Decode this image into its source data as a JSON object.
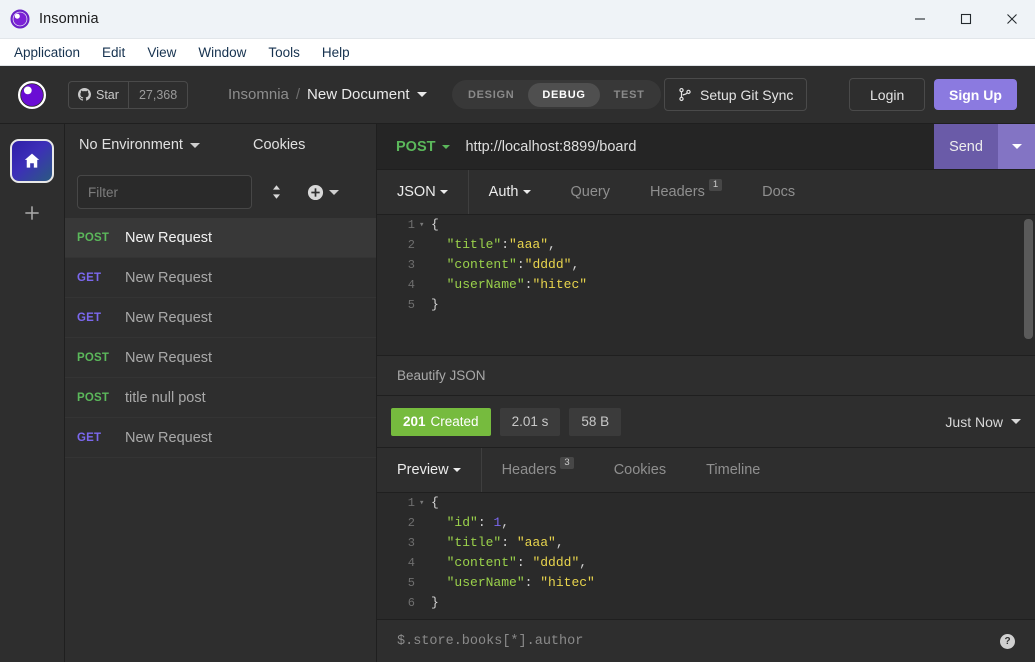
{
  "window": {
    "title": "Insomnia",
    "app_icon": "insomnia-logo-icon",
    "controls": {
      "minimize": "minimize-icon",
      "maximize": "maximize-icon",
      "close": "close-icon"
    }
  },
  "menubar": {
    "items": [
      "Application",
      "Edit",
      "View",
      "Window",
      "Tools",
      "Help"
    ]
  },
  "appheader": {
    "logo": "insomnia-logo-icon",
    "star": {
      "icon": "github-icon",
      "label": "Star",
      "count": "27,368"
    },
    "breadcrumb": {
      "app": "Insomnia",
      "separator": "/",
      "document": "New Document",
      "caret": "chevron-down-icon"
    },
    "modes": [
      {
        "label": "DESIGN",
        "active": false
      },
      {
        "label": "DEBUG",
        "active": true
      },
      {
        "label": "TEST",
        "active": false
      }
    ],
    "git_sync": {
      "icon": "git-branch-icon",
      "label": "Setup Git Sync"
    },
    "login": "Login",
    "signup": "Sign Up",
    "accent_color": "#8b7ae0"
  },
  "rail": {
    "home": "home-icon",
    "add": "plus-icon"
  },
  "sidebar": {
    "environment": {
      "label": "No Environment",
      "caret": "chevron-down-icon"
    },
    "cookies": "Cookies",
    "filter": {
      "value": "",
      "placeholder": "Filter"
    },
    "sort_icon": "sort-updown-icon",
    "add_icon": "circle-plus-icon",
    "requests": [
      {
        "method": "POST",
        "name": "New Request",
        "selected": true
      },
      {
        "method": "GET",
        "name": "New Request",
        "selected": false
      },
      {
        "method": "GET",
        "name": "New Request",
        "selected": false
      },
      {
        "method": "POST",
        "name": "New Request",
        "selected": false
      },
      {
        "method": "POST",
        "name": "title null post",
        "selected": false
      },
      {
        "method": "GET",
        "name": "New Request",
        "selected": false
      }
    ]
  },
  "request": {
    "method": "POST",
    "url": "http://localhost:8899/board",
    "send_label": "Send",
    "send_caret": "chevron-down-icon",
    "tabs": [
      {
        "label": "JSON",
        "caret": true,
        "active": true,
        "badge": null
      },
      {
        "label": "Auth",
        "caret": true,
        "active": true,
        "badge": null
      },
      {
        "label": "Query",
        "caret": false,
        "active": false,
        "badge": null
      },
      {
        "label": "Headers",
        "caret": false,
        "active": false,
        "badge": "1"
      },
      {
        "label": "Docs",
        "caret": false,
        "active": false,
        "badge": null
      }
    ],
    "body_lines": [
      {
        "num": "1",
        "fold": true,
        "indent": 0,
        "tokens": [
          {
            "t": "{",
            "c": "p"
          }
        ]
      },
      {
        "num": "2",
        "fold": false,
        "indent": 1,
        "tokens": [
          {
            "t": "\"title\"",
            "c": "jk"
          },
          {
            "t": ":",
            "c": "p"
          },
          {
            "t": "\"aaa\"",
            "c": "s"
          },
          {
            "t": ",",
            "c": "p"
          }
        ]
      },
      {
        "num": "3",
        "fold": false,
        "indent": 1,
        "tokens": [
          {
            "t": "\"content\"",
            "c": "jk"
          },
          {
            "t": ":",
            "c": "p"
          },
          {
            "t": "\"dddd\"",
            "c": "s"
          },
          {
            "t": ",",
            "c": "p"
          }
        ]
      },
      {
        "num": "4",
        "fold": false,
        "indent": 1,
        "tokens": [
          {
            "t": "\"userName\"",
            "c": "jk"
          },
          {
            "t": ":",
            "c": "p"
          },
          {
            "t": "\"hitec\"",
            "c": "s"
          }
        ]
      },
      {
        "num": "5",
        "fold": false,
        "indent": 0,
        "tokens": [
          {
            "t": "}",
            "c": "p"
          }
        ]
      }
    ],
    "beautify": "Beautify JSON"
  },
  "response": {
    "status": {
      "code": "201",
      "text": "Created",
      "color": "#76bb3e"
    },
    "time": "2.01 s",
    "size": "58 B",
    "timestamp": {
      "label": "Just Now",
      "caret": "chevron-down-icon"
    },
    "tabs": [
      {
        "label": "Preview",
        "caret": true,
        "active": true,
        "badge": null
      },
      {
        "label": "Headers",
        "caret": false,
        "active": false,
        "badge": "3"
      },
      {
        "label": "Cookies",
        "caret": false,
        "active": false,
        "badge": null
      },
      {
        "label": "Timeline",
        "caret": false,
        "active": false,
        "badge": null
      }
    ],
    "body_lines": [
      {
        "num": "1",
        "fold": true,
        "indent": 0,
        "tokens": [
          {
            "t": "{",
            "c": "p"
          }
        ]
      },
      {
        "num": "2",
        "fold": false,
        "indent": 1,
        "tokens": [
          {
            "t": "\"id\"",
            "c": "jk"
          },
          {
            "t": ": ",
            "c": "p"
          },
          {
            "t": "1",
            "c": "n"
          },
          {
            "t": ",",
            "c": "p"
          }
        ]
      },
      {
        "num": "3",
        "fold": false,
        "indent": 1,
        "tokens": [
          {
            "t": "\"title\"",
            "c": "jk"
          },
          {
            "t": ": ",
            "c": "p"
          },
          {
            "t": "\"aaa\"",
            "c": "s"
          },
          {
            "t": ",",
            "c": "p"
          }
        ]
      },
      {
        "num": "4",
        "fold": false,
        "indent": 1,
        "tokens": [
          {
            "t": "\"content\"",
            "c": "jk"
          },
          {
            "t": ": ",
            "c": "p"
          },
          {
            "t": "\"dddd\"",
            "c": "s"
          },
          {
            "t": ",",
            "c": "p"
          }
        ]
      },
      {
        "num": "5",
        "fold": false,
        "indent": 1,
        "tokens": [
          {
            "t": "\"userName\"",
            "c": "jk"
          },
          {
            "t": ": ",
            "c": "p"
          },
          {
            "t": "\"hitec\"",
            "c": "s"
          }
        ]
      },
      {
        "num": "6",
        "fold": false,
        "indent": 0,
        "tokens": [
          {
            "t": "}",
            "c": "p"
          }
        ]
      }
    ],
    "filter": {
      "value": "",
      "placeholder": "$.store.books[*].author",
      "help": "?"
    }
  }
}
